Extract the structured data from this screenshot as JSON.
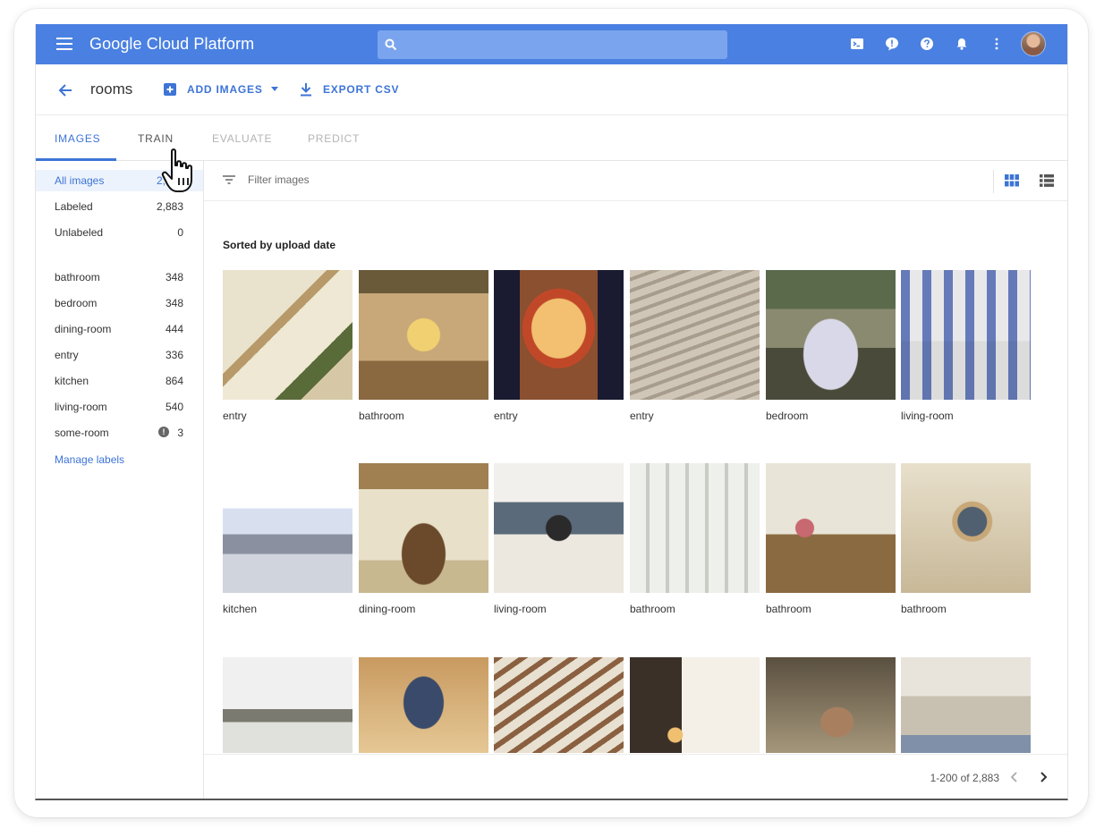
{
  "topbar": {
    "app_title": "Google Cloud Platform",
    "search_placeholder": "",
    "icons": [
      "menu-icon",
      "search-icon",
      "cloud-shell-icon",
      "feedback-icon",
      "help-icon",
      "notifications-icon",
      "more-vert-icon",
      "avatar"
    ]
  },
  "header": {
    "dataset_name": "rooms",
    "add_images_label": "ADD IMAGES",
    "export_csv_label": "EXPORT CSV"
  },
  "tabs": [
    {
      "label": "IMAGES",
      "state": "active"
    },
    {
      "label": "TRAIN",
      "state": "enabled"
    },
    {
      "label": "EVALUATE",
      "state": "disabled"
    },
    {
      "label": "PREDICT",
      "state": "disabled"
    }
  ],
  "sidebar": {
    "filters": [
      {
        "label": "All images",
        "count": "2,883",
        "selected": true
      },
      {
        "label": "Labeled",
        "count": "2,883"
      },
      {
        "label": "Unlabeled",
        "count": "0"
      }
    ],
    "labels": [
      {
        "label": "bathroom",
        "count": "348"
      },
      {
        "label": "bedroom",
        "count": "348"
      },
      {
        "label": "dining-room",
        "count": "444"
      },
      {
        "label": "entry",
        "count": "336"
      },
      {
        "label": "kitchen",
        "count": "864"
      },
      {
        "label": "living-room",
        "count": "540"
      },
      {
        "label": "some-room",
        "count": "3",
        "warning": true
      }
    ],
    "manage_labels": "Manage labels"
  },
  "main": {
    "filter_placeholder": "Filter images",
    "sort_label": "Sorted by upload date",
    "images": [
      {
        "label": "entry"
      },
      {
        "label": "bathroom"
      },
      {
        "label": "entry"
      },
      {
        "label": "entry"
      },
      {
        "label": "bedroom"
      },
      {
        "label": "living-room"
      },
      {
        "label": "kitchen"
      },
      {
        "label": "dining-room"
      },
      {
        "label": "living-room"
      },
      {
        "label": "bathroom"
      },
      {
        "label": "bathroom"
      },
      {
        "label": "bathroom"
      },
      {
        "label": ""
      },
      {
        "label": ""
      },
      {
        "label": ""
      },
      {
        "label": ""
      },
      {
        "label": ""
      },
      {
        "label": ""
      }
    ],
    "pagination": "1-200 of 2,883"
  },
  "colors": {
    "brand_blue": "#4a80e1",
    "accent": "#3d74d6"
  }
}
